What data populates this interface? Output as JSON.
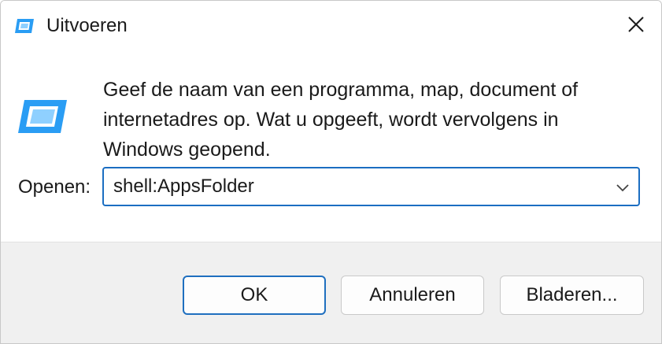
{
  "window": {
    "title": "Uitvoeren",
    "title_icon": "run-icon",
    "close_icon": "close-icon"
  },
  "main": {
    "icon": "run-icon",
    "description_lines": [
      "Geef de naam van een programma, map, document of",
      "internetadres op. Wat u opgeeft, wordt vervolgens in",
      "Windows geopend."
    ],
    "open_label": "Openen:",
    "open_value": "shell:AppsFolder",
    "dropdown_icon": "chevron-down-icon"
  },
  "footer": {
    "ok_label": "OK",
    "cancel_label": "Annuleren",
    "browse_label": "Bladeren..."
  },
  "colors": {
    "accent": "#1b6ec2",
    "icon_fill": "#2a9df4",
    "footer_bg": "#f0f0f0"
  }
}
